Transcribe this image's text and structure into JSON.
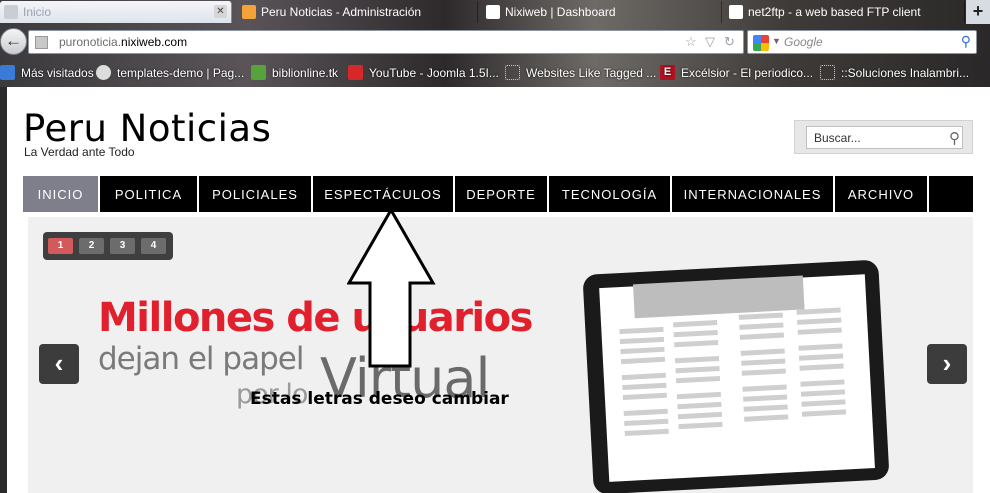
{
  "browser": {
    "tabs": [
      {
        "label": "Inicio",
        "active": true
      },
      {
        "label": "Peru Noticias - Administración",
        "active": false
      },
      {
        "label": "Nixiweb | Dashboard",
        "active": false
      },
      {
        "label": "net2ftp - a web based FTP client",
        "active": false
      }
    ],
    "new_tab_label": "+",
    "url_prefix": "puronoticia.",
    "url_domain": "nixiweb.com",
    "search_placeholder": "Google",
    "bookmarks": [
      {
        "label": "Más visitados",
        "icon": "bookmarks-icon",
        "color": "#3b7ad6"
      },
      {
        "label": "templates-demo | Pag...",
        "icon": "joomla-icon",
        "color": "#dddddd"
      },
      {
        "label": "biblionline.tk",
        "icon": "site-icon",
        "color": "#55a33a"
      },
      {
        "label": "YouTube - Joomla 1.5I...",
        "icon": "youtube-icon",
        "color": "#d62828"
      },
      {
        "label": "Websites Like Tagged ...",
        "icon": "page-icon",
        "color": "#999999"
      },
      {
        "label": "Excélsior - El periodico...",
        "icon": "excelsior-icon",
        "color": "#b01020"
      },
      {
        "label": "::Soluciones Inalambri...",
        "icon": "page-icon",
        "color": "#999999"
      }
    ]
  },
  "site": {
    "title": "Peru Noticias",
    "tagline": "La Verdad ante Todo",
    "search_placeholder": "Buscar..."
  },
  "menu": [
    {
      "label": "INICIO",
      "active": true
    },
    {
      "label": "POLITICA",
      "active": false
    },
    {
      "label": "POLICIALES",
      "active": false
    },
    {
      "label": "ESPECTÁCULOS",
      "active": false
    },
    {
      "label": "DEPORTE",
      "active": false
    },
    {
      "label": "TECNOLOGÍA",
      "active": false
    },
    {
      "label": "INTERNACIONALES",
      "active": false
    },
    {
      "label": "ARCHIVO",
      "active": false
    }
  ],
  "slider": {
    "pages": [
      "1",
      "2",
      "3",
      "4"
    ],
    "current_page": "1",
    "headline_1": "Millones de usuarios",
    "headline_2": "dejan el papel",
    "headline_3": "por lo",
    "headline_4": "Virtual",
    "prev_label": "‹",
    "next_label": "›"
  },
  "annotation": {
    "text": "Estas letras deseo cambiar"
  },
  "colors": {
    "menu_bg": "#000000",
    "menu_active": "#7f7f8c",
    "headline_red": "#e0212d",
    "pager_active": "#d35a5a"
  }
}
